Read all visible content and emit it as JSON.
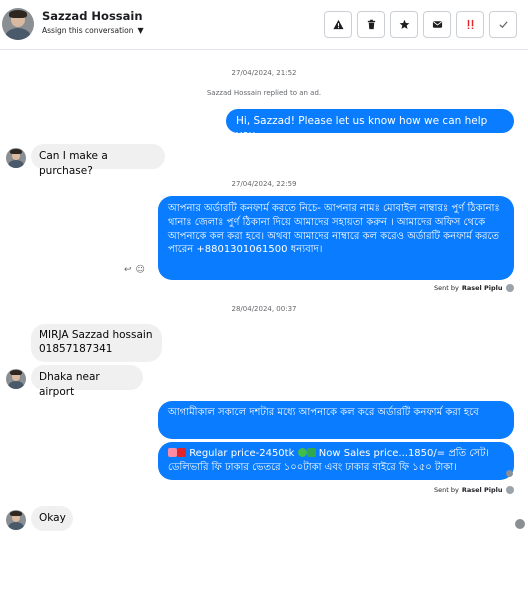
{
  "header": {
    "contact_name": "Sazzad Hossain",
    "assign_label": "Assign this conversation",
    "actions": [
      {
        "name": "report-icon",
        "glyph": "!"
      },
      {
        "name": "trash-icon",
        "glyph": "🗑"
      },
      {
        "name": "star-icon",
        "glyph": "★"
      },
      {
        "name": "mail-icon",
        "glyph": "✉"
      },
      {
        "name": "spam-icon",
        "glyph": "!"
      },
      {
        "name": "check-icon",
        "glyph": "✓"
      }
    ]
  },
  "thread": {
    "ts1": "27/04/2024, 21:52",
    "system_note": "Sazzad Hossain replied to an ad.",
    "out1": "Hi, Sazzad! Please let us know how we can help you.",
    "in1": "Can I make a purchase?",
    "ts2": "27/04/2024, 22:59",
    "out2": "আপনার অর্ডারটি কনফার্ম করতে নিচে- আপনার নামঃ মোবাইল নাম্বারঃ পুর্ণ ঠিকানাঃ থানাঃ জেলাঃ পুর্ণ ঠিকানা দিয়ে আমাদের সহায়তা করুন । আমাদের অফিস থেকে আপনাকে কল করা হবে। অথবা আমাদের নাম্বারে কল করেও অর্ডারটি কনফার্ম করতে পারেন +8801301061500 ধন্যবাদ।",
    "sent_by_prefix": "Sent by",
    "sent_by_name": "Rasel Piplu",
    "ts3": "28/04/2024, 00:37",
    "in2_line1": "MIRJA Sazzad hossain",
    "in2_line2": "01857187341",
    "in3": "Dhaka near airport",
    "out3": "আগামীকাল সকালে দশটার মধ্যে আপনাকে কল করে অর্ডারটি কনফার্ম করা হবে",
    "out4_prefix": "Regular price-2450tk",
    "out4_mid": "Now Sales price...1850/= প্রতি সেট।",
    "out4_line2": "ডেলিভারি ফি ঢাকার ভেতরে ১০০টাকা এবং ঢাকার বাইরে ফি ১৫০ টাকা।",
    "in4": "Okay"
  }
}
